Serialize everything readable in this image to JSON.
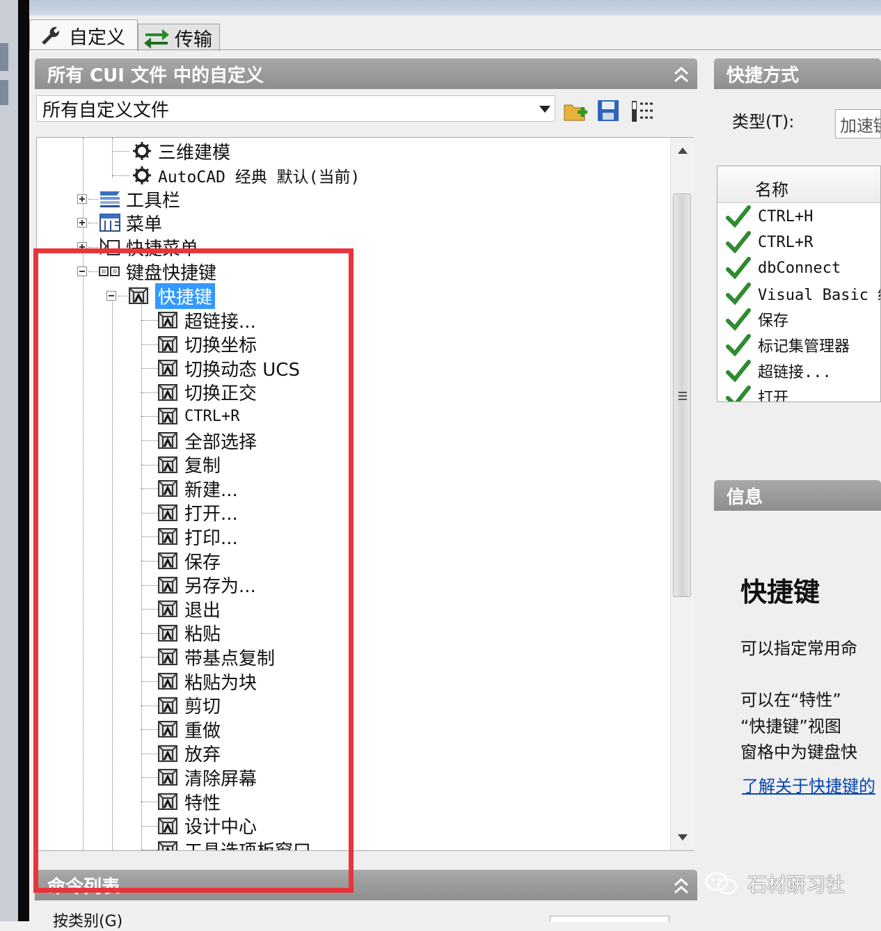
{
  "tabs": {
    "customize": "自定义",
    "transfer": "传输"
  },
  "customizations_panel": {
    "title": "所有 CUI 文件 中的自定义",
    "combo_value": "所有自定义文件"
  },
  "tree": {
    "workspaces": [
      "三维建模",
      "AutoCAD 经典 默认(当前)"
    ],
    "toolbars": "工具栏",
    "menus": "菜单",
    "shortcut_menus": "快捷菜单",
    "keyboard_shortcuts": "键盘快捷键",
    "shortcut_keys": "快捷键",
    "items": [
      "超链接...",
      "切换坐标",
      "切换动态 UCS",
      "切换正交",
      "CTRL+R",
      "全部选择",
      "复制",
      "新建...",
      "打开...",
      "打印...",
      "保存",
      "另存为...",
      "退出",
      "粘贴",
      "带基点复制",
      "粘贴为块",
      "剪切",
      "重做",
      "放弃",
      "清除屏幕",
      "特性",
      "设计中心",
      "工具选项板窗口"
    ]
  },
  "properties_panel": {
    "title": "命令列表",
    "search_label": "按类别(G)"
  },
  "shortcuts_panel": {
    "title": "快捷方式",
    "type_label": "类型(T):",
    "type_value": "加速键",
    "column_name": "名称",
    "items": [
      "CTRL+H",
      "CTRL+R",
      "dbConnect",
      "Visual Basic 编辑器",
      "保存",
      "标记集管理器",
      "超链接...",
      "打开"
    ]
  },
  "info_panel": {
    "title": "信息",
    "heading": "快捷键",
    "lines": [
      "可以指定常用命",
      "可以在“特性”",
      "“快捷键”视图",
      "窗格中为键盘快"
    ],
    "link": "了解关于快捷键的"
  },
  "watermark": "石材研习社",
  "colors": {
    "highlight": "#e8343a",
    "selection": "#3399ff",
    "check": "#2e8b2e",
    "header": "#9a9a9a"
  }
}
